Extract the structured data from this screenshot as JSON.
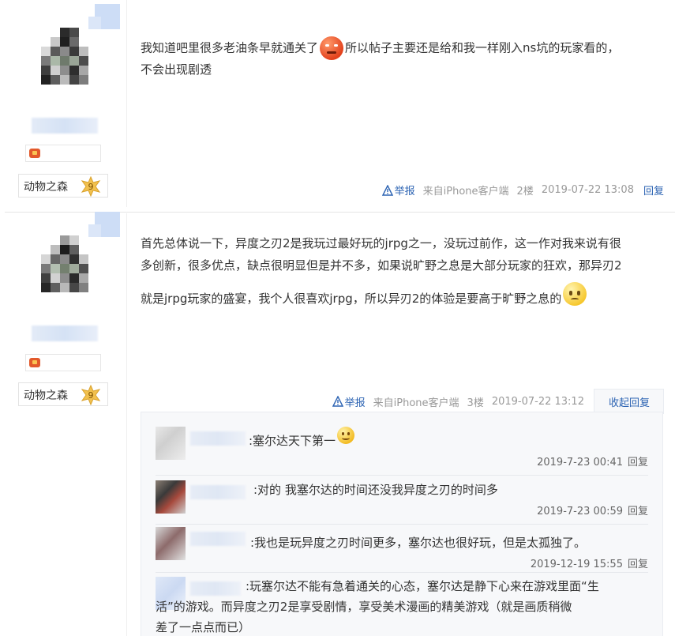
{
  "posts": [
    {
      "author": {
        "level_name": "动物之森",
        "level_num": "9"
      },
      "content": {
        "line1_a": "我知道吧里很多老油条早就通关了",
        "line1_b": "所以帖子主要还是给和我一样刚入ns坑的玩家看的，",
        "line2": "不会出现剧透",
        "emoji": "angry-face-emoji"
      },
      "tail": {
        "report": "举报",
        "source": "来自iPhone客户端",
        "floor": "2楼",
        "time": "2019-07-22 13:08",
        "reply": "回复"
      }
    },
    {
      "author": {
        "level_name": "动物之森",
        "level_num": "9"
      },
      "content": {
        "line1": "首先总体说一下，异度之刃2是我玩过最好玩的jrpg之一，没玩过前作，这一作对我来说有很",
        "line2": "多创新，很多优点，缺点很明显但是并不多，如果说旷野之息是大部分玩家的狂欢，那异刃2",
        "line3": "就是jrpg玩家的盛宴，我个人很喜欢jrpg，所以异刃2的体验是要高于旷野之息的",
        "emoji": "worried-face-emoji"
      },
      "tail": {
        "report": "举报",
        "source": "来自iPhone客户端",
        "floor": "3楼",
        "time": "2019-07-22 13:12",
        "collapse": "收起回复"
      },
      "replies": [
        {
          "text": ":塞尔达天下第一",
          "time": "2019-7-23 00:41",
          "reply": "回复"
        },
        {
          "text": ":对的 我塞尔达的时间还没我异度之刃的时间多",
          "time": "2019-7-23 00:59",
          "reply": "回复"
        },
        {
          "text": ":我也是玩异度之刃时间更多，塞尔达也很好玩，但是太孤独了。",
          "time": "2019-12-19 15:55",
          "reply": "回复"
        },
        {
          "line1": ":玩塞尔达不能有急着通关的心态，塞尔达是静下心来在游戏里面“生",
          "line2": "活”的游戏。而异度之刃2是享受剧情，享受美术漫画的精美游戏（就是画质稍微",
          "line3": "差了一点点而已）"
        }
      ]
    }
  ],
  "colors": {
    "link": "#2d64b3",
    "meta": "#999999",
    "text": "#333333",
    "panel_bg": "#f7f8fa",
    "level_badge": "#f2c14e"
  }
}
